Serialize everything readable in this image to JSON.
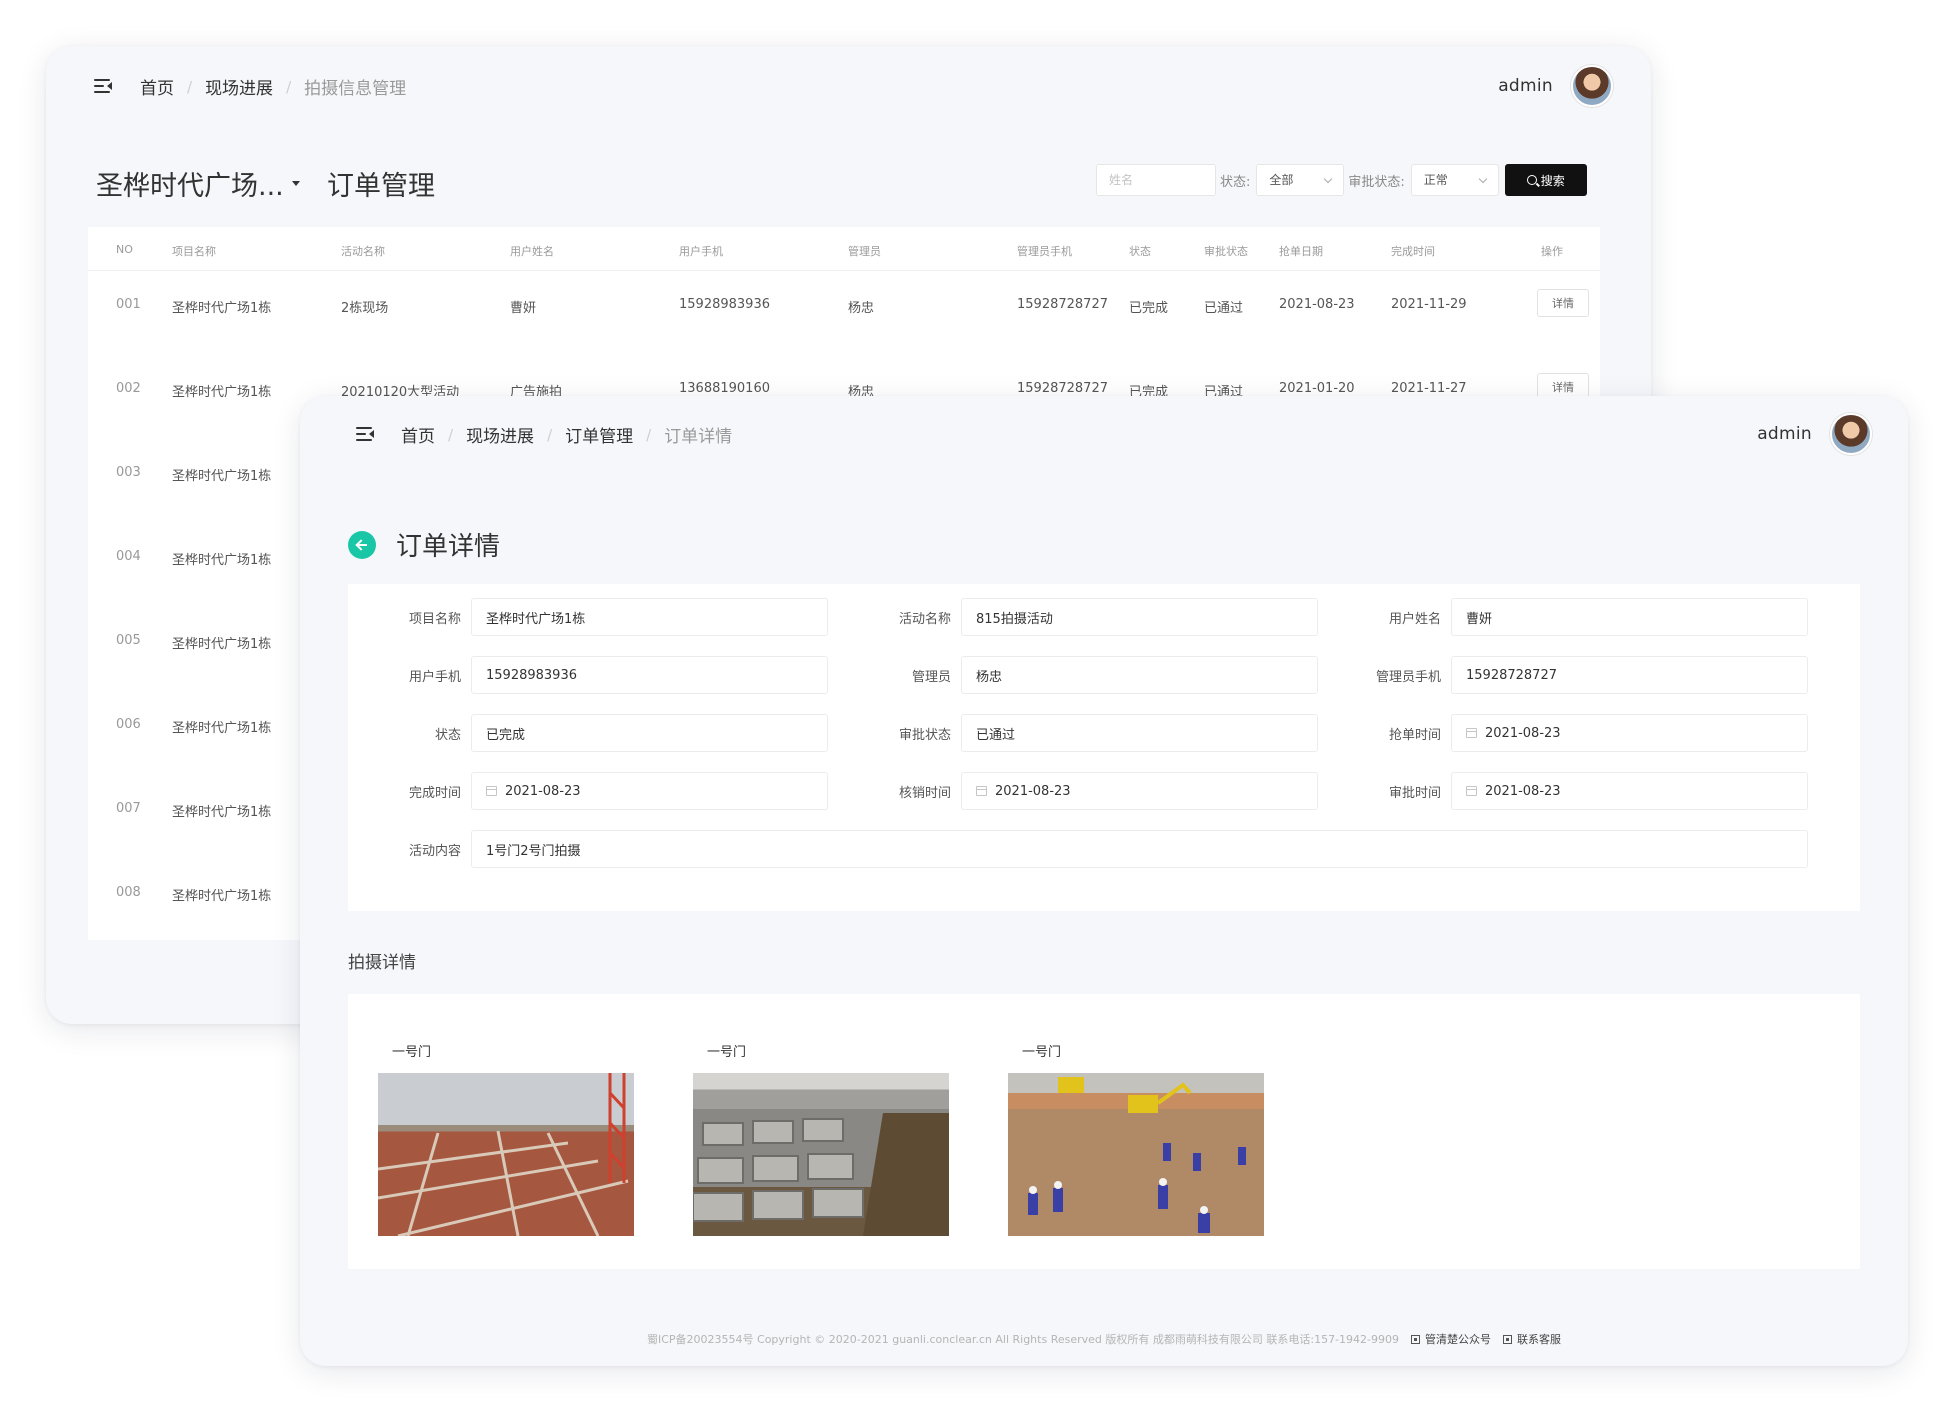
{
  "back_window": {
    "breadcrumb": [
      "首页",
      "现场进展",
      "拍摄信息管理"
    ],
    "username": "admin",
    "project_title": "圣桦时代广场...",
    "page_title": "订单管理",
    "filters": {
      "name_placeholder": "姓名",
      "status_label": "状态:",
      "status_value": "全部",
      "approval_label": "审批状态:",
      "approval_value": "正常",
      "search_label": "搜索"
    },
    "table": {
      "headers": [
        "NO",
        "项目名称",
        "活动名称",
        "用户姓名",
        "用户手机",
        "管理员",
        "管理员手机",
        "状态",
        "审批状态",
        "抢单日期",
        "完成时间",
        "操作"
      ],
      "rows": [
        {
          "no": "001",
          "project": "圣桦时代广场1栋",
          "activity": "2栋现场",
          "user": "曹妍",
          "phone": "15928983936",
          "admin": "杨忠",
          "admin_phone": "15928728727",
          "status": "已完成",
          "approval": "已通过",
          "grab_date": "2021-08-23",
          "done_date": "2021-11-29",
          "action": "详情"
        },
        {
          "no": "002",
          "project": "圣桦时代广场1栋",
          "activity": "20210120大型活动",
          "user": "广告施拍",
          "phone": "13688190160",
          "admin": "杨忠",
          "admin_phone": "15928728727",
          "status": "已完成",
          "approval": "已通过",
          "grab_date": "2021-01-20",
          "done_date": "2021-11-27",
          "action": "详情"
        },
        {
          "no": "003",
          "project": "圣桦时代广场1栋"
        },
        {
          "no": "004",
          "project": "圣桦时代广场1栋"
        },
        {
          "no": "005",
          "project": "圣桦时代广场1栋"
        },
        {
          "no": "006",
          "project": "圣桦时代广场1栋"
        },
        {
          "no": "007",
          "project": "圣桦时代广场1栋"
        },
        {
          "no": "008",
          "project": "圣桦时代广场1栋"
        }
      ]
    }
  },
  "front_window": {
    "breadcrumb": [
      "首页",
      "现场进展",
      "订单管理",
      "订单详情"
    ],
    "username": "admin",
    "title": "订单详情",
    "fields": {
      "project_name": {
        "label": "项目名称",
        "value": "圣桦时代广场1栋"
      },
      "activity_name": {
        "label": "活动名称",
        "value": "815拍摄活动"
      },
      "user_name": {
        "label": "用户姓名",
        "value": "曹妍"
      },
      "user_phone": {
        "label": "用户手机",
        "value": "15928983936"
      },
      "admin": {
        "label": "管理员",
        "value": "杨忠"
      },
      "admin_phone": {
        "label": "管理员手机",
        "value": "15928728727"
      },
      "status": {
        "label": "状态",
        "value": "已完成"
      },
      "approval_status": {
        "label": "审批状态",
        "value": "已通过"
      },
      "grab_time": {
        "label": "抢单时间",
        "value": "2021-08-23"
      },
      "finish_time": {
        "label": "完成时间",
        "value": "2021-08-23"
      },
      "verify_time": {
        "label": "核销时间",
        "value": "2021-08-23"
      },
      "approval_time": {
        "label": "审批时间",
        "value": "2021-08-23"
      },
      "activity_content": {
        "label": "活动内容",
        "value": "1号门2号门拍摄"
      }
    },
    "shoot_section_title": "拍摄详情",
    "photos": [
      {
        "caption": "一号门"
      },
      {
        "caption": "一号门"
      },
      {
        "caption": "一号门"
      }
    ],
    "footer": {
      "text": "蜀ICP备20023554号 Copyright © 2020-2021 guanli.conclear.cn All Rights Reserved 版权所有 成都雨萌科技有限公司 联系电话:157-1942-9909",
      "link1": "管清楚公众号",
      "link2": "联系客服"
    }
  }
}
